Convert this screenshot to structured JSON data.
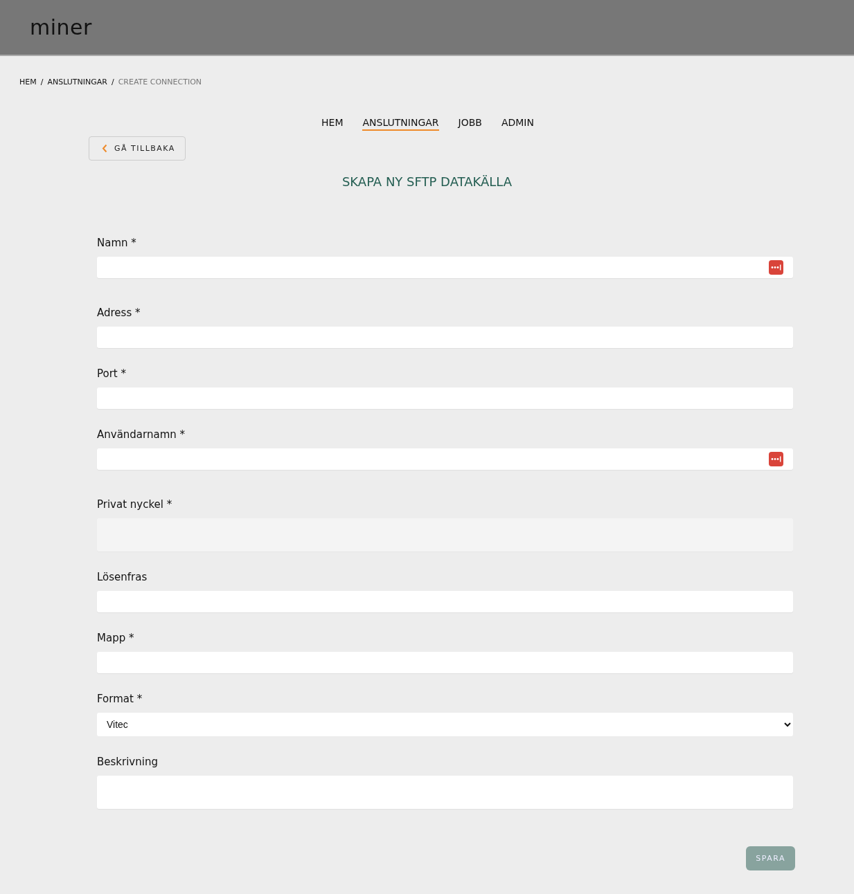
{
  "header": {
    "logo": "miner"
  },
  "breadcrumb": [
    {
      "label": "HEM",
      "current": false
    },
    {
      "label": "ANSLUTNINGAR",
      "current": false
    },
    {
      "label": "CREATE CONNECTION",
      "current": true
    }
  ],
  "breadcrumb_separator": "/",
  "nav": [
    {
      "label": "HEM",
      "selected": false
    },
    {
      "label": "ANSLUTNINGAR",
      "selected": true
    },
    {
      "label": "JOBB",
      "selected": false
    },
    {
      "label": "ADMIN",
      "selected": false
    }
  ],
  "back_button": {
    "label": "GÅ TILLBAKA"
  },
  "title": "SKAPA NY SFTP DATAKÄLLA",
  "fields": [
    {
      "kind": "text",
      "label": "Namn *",
      "autofill": true
    },
    {
      "kind": "text",
      "label": "Adress *",
      "autofill": false
    },
    {
      "kind": "text",
      "label": "Port *",
      "autofill": false
    },
    {
      "kind": "text",
      "label": "Användarnamn *",
      "autofill": true
    },
    {
      "kind": "keyarea",
      "label": "Privat nyckel *",
      "autofill": false
    },
    {
      "kind": "text",
      "label": "Lösenfras",
      "autofill": false
    },
    {
      "kind": "text",
      "label": "Mapp *",
      "autofill": false
    },
    {
      "kind": "select",
      "label": "Format *",
      "value": "Vitec",
      "autofill": false
    },
    {
      "kind": "textarea",
      "label": "Beskrivning",
      "autofill": false
    }
  ],
  "save_button": {
    "label": "SPARA",
    "disabled": true
  }
}
